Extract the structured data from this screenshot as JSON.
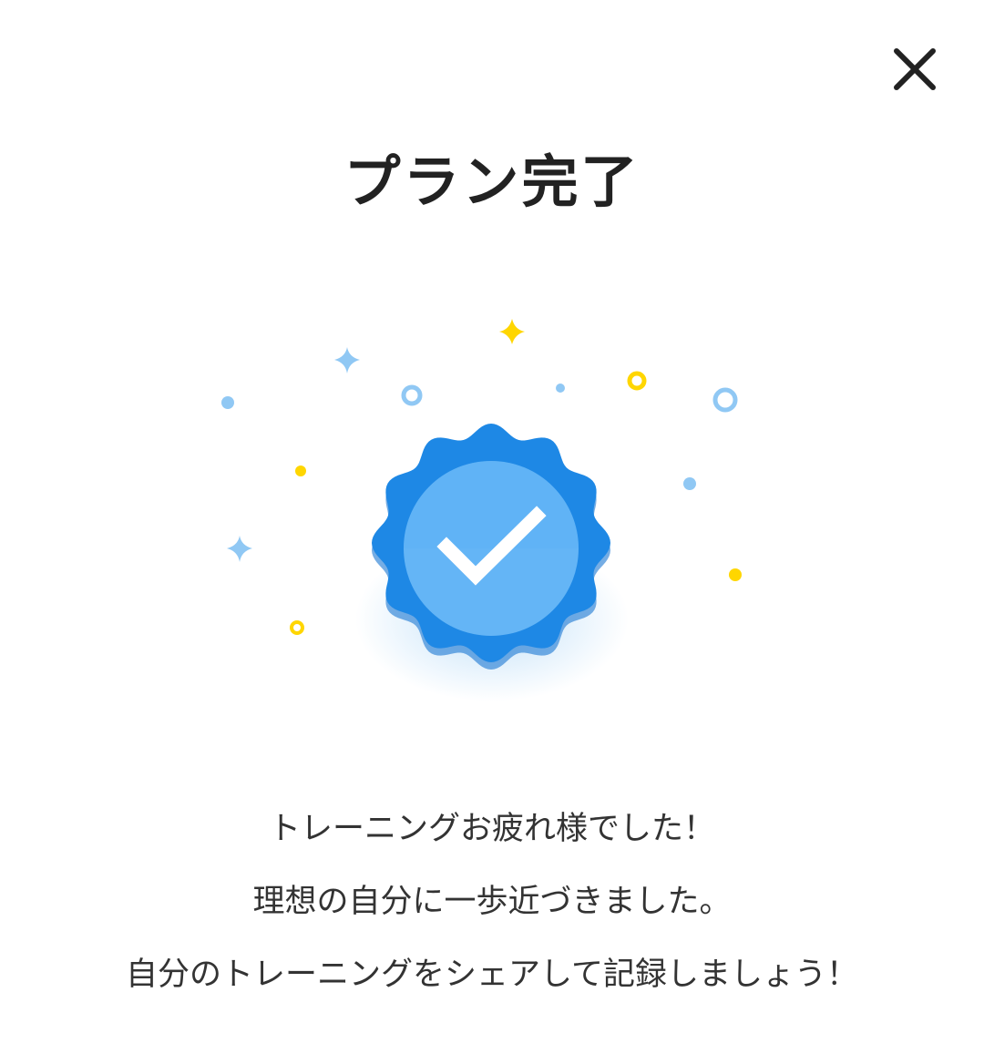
{
  "header": {
    "close_icon": "close-icon"
  },
  "title": "プラン完了",
  "badge": {
    "icon": "check-badge-icon",
    "colors": {
      "outer": "#1E88E5",
      "outer_dark": "#1976D2",
      "inner": "#64B5F6",
      "check": "#ffffff"
    }
  },
  "confetti_colors": {
    "blue": "#90C8F4",
    "yellow": "#FFD600"
  },
  "message": {
    "line1": "トレーニングお疲れ様でした！",
    "line2": "理想の自分に一歩近づきました。",
    "line3": "自分のトレーニングをシェアして記録しましょう！"
  }
}
